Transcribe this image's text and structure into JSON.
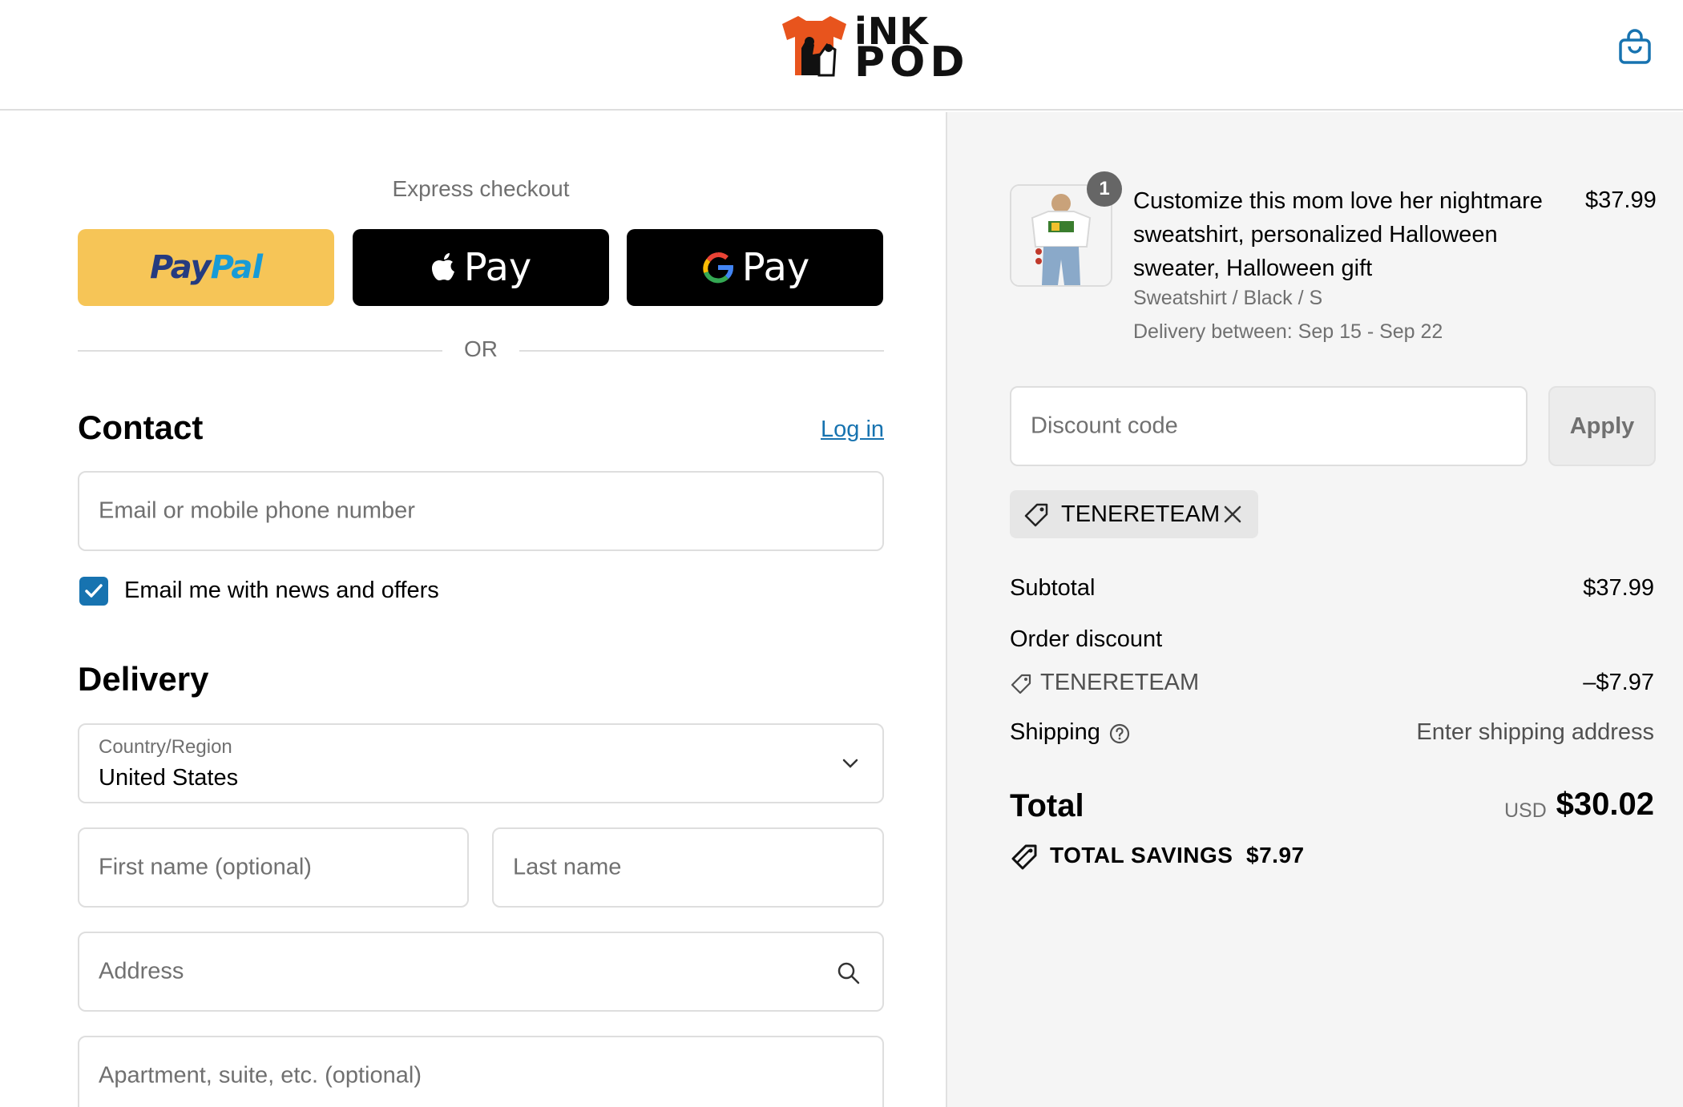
{
  "header": {
    "logo_top": "iNK",
    "logo_bottom": "POD",
    "cart_icon": "shopping-bag-icon"
  },
  "express": {
    "title": "Express checkout",
    "paypal_pay": "Pay",
    "paypal_pal": "Pal",
    "apple_label": "Pay",
    "google_label": "Pay",
    "divider": "OR"
  },
  "contact": {
    "title": "Contact",
    "login_link": "Log in",
    "email_placeholder": "Email or mobile phone number",
    "newsletter_label": "Email me with news and offers",
    "newsletter_checked": true
  },
  "delivery": {
    "title": "Delivery",
    "country_label": "Country/Region",
    "country_value": "United States",
    "first_name_placeholder": "First name (optional)",
    "last_name_placeholder": "Last name",
    "address_placeholder": "Address",
    "apartment_placeholder": "Apartment, suite, etc. (optional)"
  },
  "order": {
    "quantity": "1",
    "product_title": "Customize this mom love her nightmare sweatshirt, personalized Halloween sweater, Halloween gift",
    "product_price": "$37.99",
    "variant": "Sweatshirt / Black / S",
    "delivery": "Delivery between: Sep 15 - Sep 22",
    "discount_placeholder": "Discount code",
    "apply_label": "Apply",
    "applied_code": "TENERETEAM",
    "subtotal_label": "Subtotal",
    "subtotal_value": "$37.99",
    "order_discount_label": "Order discount",
    "discount_code": "TENERETEAM",
    "discount_value": "–$7.97",
    "shipping_label": "Shipping",
    "shipping_value": "Enter shipping address",
    "total_label": "Total",
    "total_currency": "USD",
    "total_value": "$30.02",
    "savings_label": "TOTAL SAVINGS",
    "savings_value": "$7.97"
  },
  "colors": {
    "accent": "#1773b0",
    "paypal_yellow": "#f6c557",
    "panel_gray": "#f5f5f5"
  }
}
